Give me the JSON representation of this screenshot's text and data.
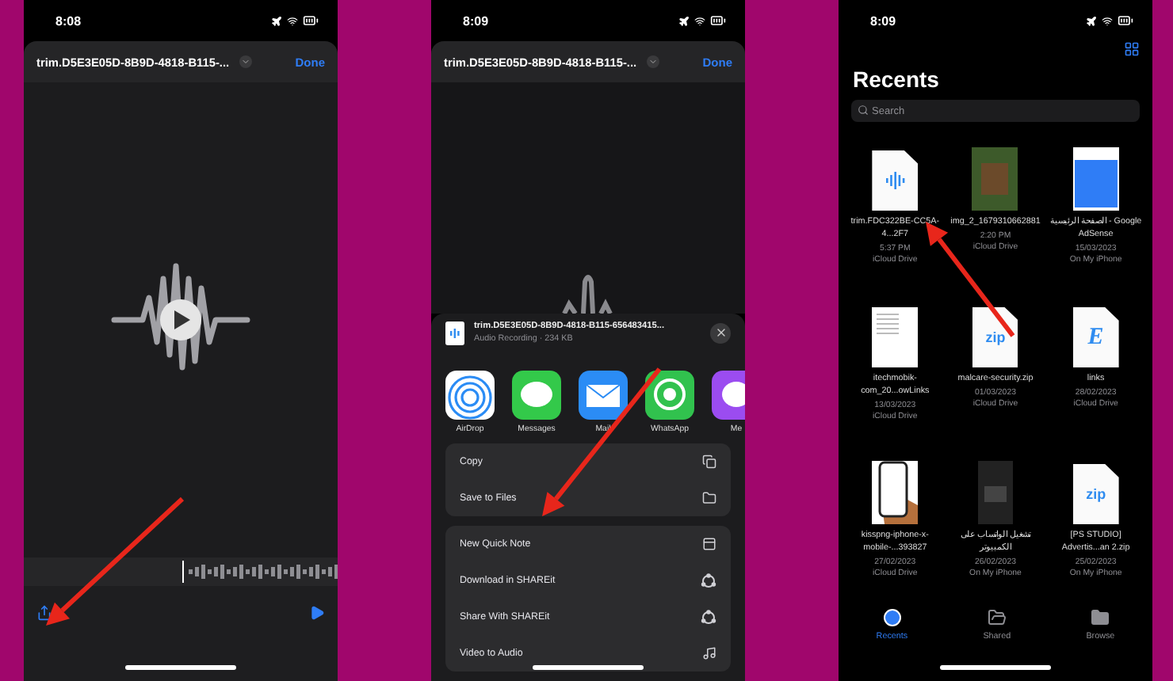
{
  "player": {
    "status_time": "8:08",
    "title": "trim.D5E3E05D-8B9D-4818-B115-...",
    "done": "Done"
  },
  "share": {
    "status_time": "8:09",
    "title": "trim.D5E3E05D-8B9D-4818-B115-...",
    "done": "Done",
    "file_name": "trim.D5E3E05D-8B9D-4818-B115-656483415...",
    "file_info": "Audio Recording · 234 KB",
    "apps": [
      {
        "kind": "airdrop",
        "label": "AirDrop"
      },
      {
        "kind": "messages",
        "label": "Messages"
      },
      {
        "kind": "mail",
        "label": "Mail"
      },
      {
        "kind": "whatsapp",
        "label": "WhatsApp"
      },
      {
        "kind": "messenger",
        "label": "Me"
      }
    ],
    "groups": [
      [
        {
          "kind": "copy",
          "label": "Copy"
        },
        {
          "kind": "folder",
          "label": "Save to Files"
        }
      ],
      [
        {
          "kind": "note",
          "label": "New Quick Note"
        },
        {
          "kind": "shareit",
          "label": "Download in SHAREit"
        },
        {
          "kind": "shareit",
          "label": "Share With SHAREit"
        },
        {
          "kind": "music",
          "label": "Video to Audio"
        }
      ]
    ]
  },
  "files": {
    "status_time": "8:09",
    "heading": "Recents",
    "search": {
      "placeholder": "Search"
    },
    "items": [
      {
        "kind": "audio",
        "name": "trim.FDC322BE-CC5A-4...2F7",
        "date": "5:37 PM",
        "location": "iCloud Drive"
      },
      {
        "kind": "photo",
        "name": "img_2_1679310662881",
        "date": "2:20 PM",
        "location": "iCloud Drive"
      },
      {
        "kind": "screenshot",
        "name": "الصفحة الرئيسية - Google AdSense",
        "date": "15/03/2023",
        "location": "On My iPhone"
      },
      {
        "kind": "document",
        "name": "itechmobik-com_20...owLinks",
        "date": "13/03/2023",
        "location": "iCloud Drive"
      },
      {
        "kind": "zip",
        "glyph": "zip",
        "name": "malcare-security.zip",
        "date": "01/03/2023",
        "location": "iCloud Drive"
      },
      {
        "kind": "letter",
        "glyph": "E",
        "name": "links",
        "date": "28/02/2023",
        "location": "iCloud Drive"
      },
      {
        "kind": "phone",
        "name": "kisspng-iphone-x-mobile-...393827",
        "date": "27/02/2023",
        "location": "iCloud Drive"
      },
      {
        "kind": "dark",
        "name": "تشغيل الواتساب على الكمبيوتر",
        "date": "26/02/2023",
        "location": "On My iPhone"
      },
      {
        "kind": "zip",
        "glyph": "zip",
        "name": "[PS STUDIO] Advertis...an 2.zip",
        "date": "25/02/2023",
        "location": "On My iPhone"
      }
    ],
    "tabs": [
      {
        "kind": "clock",
        "label": "Recents",
        "selected": true
      },
      {
        "kind": "shared",
        "label": "Shared",
        "selected": false
      },
      {
        "kind": "folder",
        "label": "Browse",
        "selected": false
      }
    ]
  }
}
